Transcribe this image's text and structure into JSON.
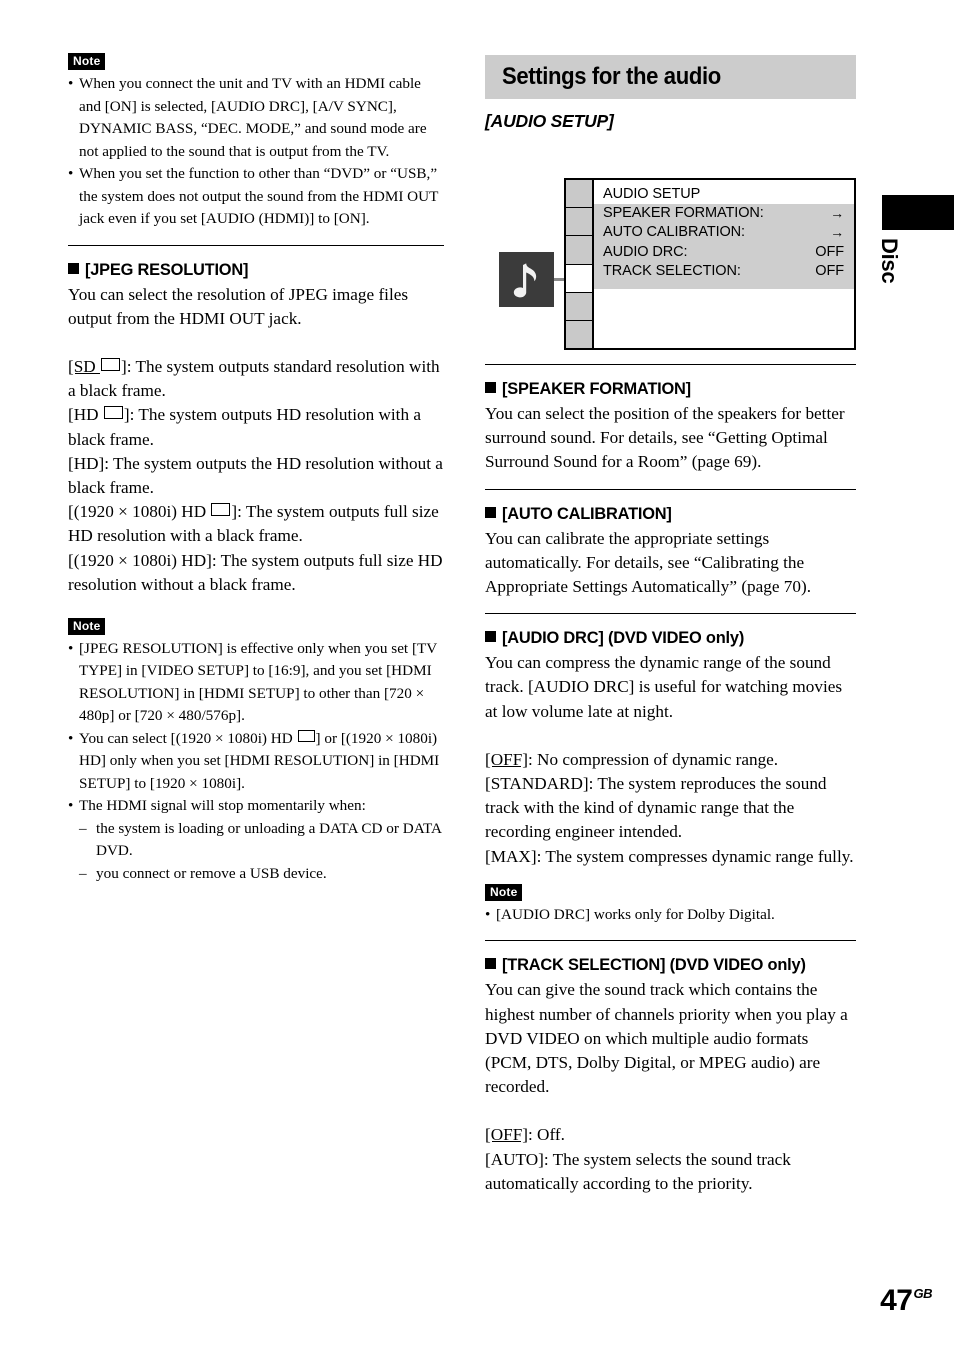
{
  "page": {
    "number": "47",
    "region_suffix": "GB"
  },
  "edge_tab": {
    "label": "Disc"
  },
  "left_column": {
    "note_top": {
      "badge": "Note",
      "items": [
        "When you connect the unit and TV with an HDMI cable and [ON] is selected, [AUDIO DRC], [A/V SYNC], DYNAMIC BASS, “DEC. MODE,” and sound mode are not applied to the sound that is output from the TV.",
        "When you set the function to other than “DVD” or “USB,” the system does not output the sound from the HDMI OUT jack even if you set [AUDIO (HDMI)] to [ON]."
      ]
    },
    "jpeg_resolution": {
      "heading": "[JPEG RESOLUTION]",
      "intro": "You can select the resolution of JPEG image files output from the HDMI OUT jack.",
      "options": [
        {
          "label_pre": "[SD ",
          "label_post": "]",
          "underlined": true,
          "frame_icon": true,
          "text": ": The system outputs standard resolution with a black frame."
        },
        {
          "label_pre": "[HD ",
          "label_post": "]",
          "underlined": false,
          "frame_icon": true,
          "text": ": The system outputs HD resolution with a black frame."
        },
        {
          "label_pre": "[HD]",
          "label_post": "",
          "underlined": false,
          "frame_icon": false,
          "text": ": The system outputs the HD resolution without a black frame."
        },
        {
          "label_pre": "[(1920 × 1080i) HD ",
          "label_post": "]",
          "underlined": false,
          "frame_icon": true,
          "text": ": The system outputs full size HD resolution with a black frame."
        },
        {
          "label_pre": "[(1920 × 1080i) HD]",
          "label_post": "",
          "underlined": false,
          "frame_icon": false,
          "text": ": The system outputs full size HD resolution without a black frame."
        }
      ]
    },
    "note_bottom": {
      "badge": "Note",
      "item1_a": "[JPEG RESOLUTION] is effective only when you set [TV TYPE] in [VIDEO SETUP] to [16:9], and you set [HDMI RESOLUTION] in [HDMI SETUP] to other than [720 × 480p] or [720 × 480/576p].",
      "item2_a": "You can select [(1920 × 1080i) HD ",
      "item2_b": "] or [(1920 × 1080i) HD] only when you set [HDMI RESOLUTION] in [HDMI SETUP] to [1920 × 1080i].",
      "item3": "The HDMI signal will stop momentarily when:",
      "item3_sub": [
        "the system is loading or unloading a DATA CD or DATA DVD.",
        "you connect or remove a USB device."
      ]
    }
  },
  "right_column": {
    "banner_title": "Settings for the audio",
    "sub_title": "[AUDIO SETUP]",
    "osd": {
      "icon_name": "music-note-icon",
      "heading": "AUDIO SETUP",
      "rows": [
        {
          "label": "SPEAKER FORMATION:",
          "value": "→"
        },
        {
          "label": "AUTO CALIBRATION:",
          "value": "→"
        },
        {
          "label": "AUDIO DRC:",
          "value": "OFF"
        },
        {
          "label": "TRACK SELECTION:",
          "value": "OFF"
        }
      ],
      "sidebar_cell_count": 6,
      "sidebar_active_index": 3
    },
    "speaker_formation": {
      "heading": "[SPEAKER FORMATION]",
      "body": "You can select the position of the speakers for better surround sound. For details, see “Getting Optimal Surround Sound for a Room” (page 69)."
    },
    "auto_calibration": {
      "heading": "[AUTO CALIBRATION]",
      "body": "You can calibrate the appropriate settings automatically. For details, see “Calibrating the Appropriate Settings Automatically” (page 70)."
    },
    "audio_drc": {
      "heading": "[AUDIO DRC] (DVD VIDEO only)",
      "body": "You can compress the dynamic range of the sound track. [AUDIO DRC] is useful for watching movies at low volume late at night.",
      "options": [
        {
          "label": "[OFF]",
          "underlined": true,
          "text": ": No compression of dynamic range."
        },
        {
          "label": "[STANDARD]",
          "underlined": false,
          "text": ": The system reproduces the sound track with the kind of dynamic range that the recording engineer intended."
        },
        {
          "label": "[MAX]",
          "underlined": false,
          "text": ": The system compresses dynamic range fully."
        }
      ],
      "note": {
        "badge": "Note",
        "item": "[AUDIO DRC] works only for Dolby Digital."
      }
    },
    "track_selection": {
      "heading": "[TRACK SELECTION] (DVD VIDEO only)",
      "body": "You can give the sound track which contains the highest number of channels priority when you play a DVD VIDEO on which multiple audio formats (PCM, DTS, Dolby Digital, or MPEG audio) are recorded.",
      "options": [
        {
          "label": "[OFF]",
          "underlined": true,
          "text": ": Off."
        },
        {
          "label": "[AUTO]",
          "underlined": false,
          "text": ": The system selects the sound track automatically according to the priority."
        }
      ]
    }
  },
  "colors": {
    "banner_bg": "#cccccc",
    "osd_row_bg": "#cecece",
    "osd_sidebar_cell": "#c9c9c9",
    "osd_icon_bg": "#3b3b3b",
    "connector": "#8a8a8a",
    "ink": "#000000"
  }
}
